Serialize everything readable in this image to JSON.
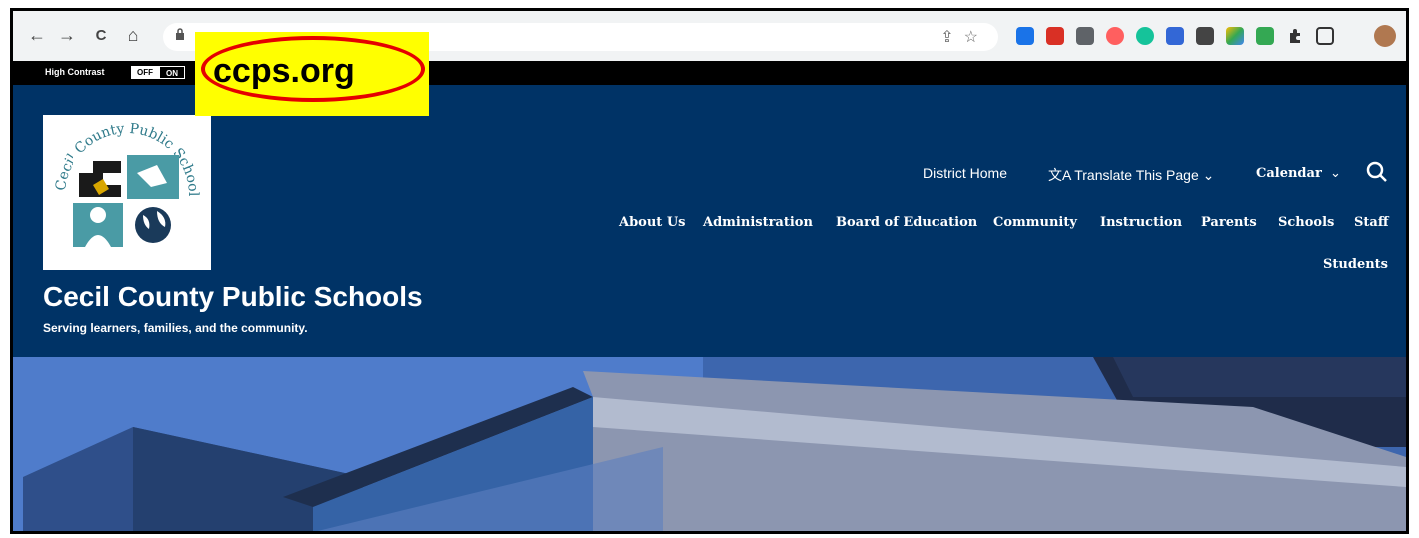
{
  "browser": {
    "url_highlight": "ccps.org",
    "nav_back": "←",
    "nav_forward": "→",
    "nav_reload": "C",
    "nav_home": "⌂",
    "lock_icon": "🔒",
    "share_icon": "⇪",
    "star_icon": "☆"
  },
  "accessibility": {
    "high_contrast_label": "High Contrast",
    "off_label": "OFF",
    "on_label": "ON"
  },
  "header": {
    "title": "Cecil County Public Schools",
    "tagline": "Serving learners, families, and the community.",
    "logo_text": "Cecil County Public Schools"
  },
  "utility_nav": {
    "district_home": "District Home",
    "translate": "Translate This Page",
    "calendar": "Calendar"
  },
  "main_nav": {
    "items": [
      "About Us",
      "Administration",
      "Board of Education",
      "Community",
      "Instruction",
      "Parents",
      "Schools",
      "Staff"
    ],
    "second_row": "Students"
  },
  "colors": {
    "header_bg": "#003366",
    "callout_bg": "#ffff00",
    "callout_ring": "#e50000"
  }
}
